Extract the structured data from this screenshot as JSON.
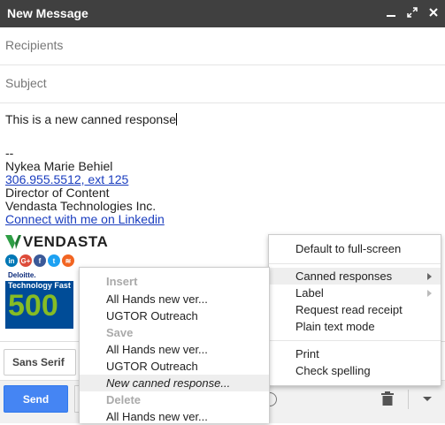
{
  "window": {
    "title": "New Message"
  },
  "compose": {
    "recipients_placeholder": "Recipients",
    "subject_placeholder": "Subject",
    "body_text": "This is a new canned response",
    "signature": {
      "dashes": "--",
      "name": "Nykea Marie Behiel",
      "phone": "306.955.5512, ext 125",
      "role": "Director of Content",
      "company": "Vendasta Technologies Inc.",
      "linkedin_text": "Connect with me on Linkedin",
      "logo_text": "VENDASTA",
      "badge": {
        "brand": "Deloitte.",
        "program": "Technology Fast",
        "number": "500"
      }
    }
  },
  "formatting": {
    "font": "Sans Serif"
  },
  "bottom": {
    "send_label": "Send"
  },
  "more_menu": {
    "items": [
      "Default to full-screen",
      "Canned responses",
      "Label",
      "Request read receipt",
      "Plain text mode",
      "Print",
      "Check spelling"
    ]
  },
  "canned_menu": {
    "insert_header": "Insert",
    "insert_items": [
      "All Hands new ver...",
      "UGTOR Outreach"
    ],
    "save_header": "Save",
    "save_items": [
      "All Hands new ver...",
      "UGTOR Outreach",
      "New canned response..."
    ],
    "delete_header": "Delete",
    "delete_items": [
      "All Hands new ver..."
    ]
  },
  "colors": {
    "titlebar": "#404040",
    "send_button": "#4585f3",
    "link": "#1a3dbf",
    "vendasta_green": "#2e9e45",
    "deloitte_blue": "#004c97",
    "deloitte_green": "#86bc25"
  }
}
